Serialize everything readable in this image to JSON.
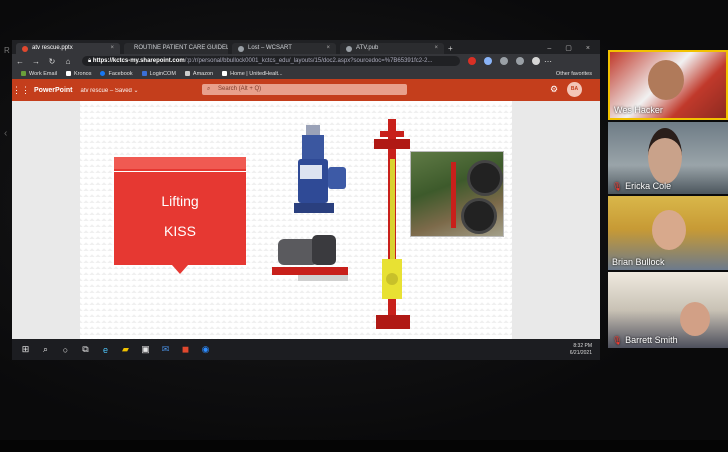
{
  "browser": {
    "tabs": [
      {
        "label": "atv rescue.pptx",
        "color": "#e0482e",
        "active": true
      },
      {
        "label": "ROUTINE PATIENT CARE GUIDEL",
        "color": "#9aa0a6",
        "active": false
      },
      {
        "label": "Lost – WCSART",
        "color": "#9aa0a6",
        "active": false
      },
      {
        "label": "ATV.pub",
        "color": "#9aa0a6",
        "active": false
      }
    ],
    "tab_close": "×",
    "new_tab": "+",
    "window_controls": [
      "–",
      "▢",
      "×"
    ],
    "url_host": "https://kctcs-my.sharepoint.com",
    "url_path": "/:p:/r/personal/bbullock0001_kctcs_edu/_layouts/15/doc2.aspx?sourcedoc=%7B65391fc2-2...",
    "bookmarks": [
      {
        "label": "Work Email",
        "color": "#6a9f3a"
      },
      {
        "label": "Kronos",
        "color": "#ffffff"
      },
      {
        "label": "Facebook",
        "color": "#1877f2"
      },
      {
        "label": "LoginCOM",
        "color": "#3b6fd6"
      },
      {
        "label": "Amazon",
        "color": "#cccccc"
      },
      {
        "label": "Home | UnitedHealt...",
        "color": "#ffffff"
      }
    ],
    "other_favorites": "Other favorites"
  },
  "powerpoint": {
    "app_name": "PowerPoint",
    "doc_name": "atv rescue – Saved ⌄",
    "search_placeholder": "Search (Alt + Q)",
    "avatar_initials": "BA",
    "accent": "#c43e1c"
  },
  "slide": {
    "line1": "Lifting",
    "line2": "KISS",
    "box_color": "#e63832"
  },
  "taskbar": {
    "time": "8:32 PM",
    "date": "6/21/2021"
  },
  "participants": [
    {
      "name": "Wes Hacker",
      "muted": false
    },
    {
      "name": "Ericka Cole",
      "muted": true
    },
    {
      "name": "Brian Bullock",
      "muted": false
    },
    {
      "name": "Barrett Smith",
      "muted": true
    }
  ],
  "icons": {
    "back": "arrow-left-icon",
    "forward": "arrow-right-icon",
    "refresh": "refresh-icon",
    "home": "home-icon",
    "lock": "lock-icon",
    "waffle": "app-launcher-icon",
    "search": "search-icon",
    "gear": "gear-icon",
    "mic_muted": "mic-muted-icon",
    "start": "windows-start-icon"
  }
}
